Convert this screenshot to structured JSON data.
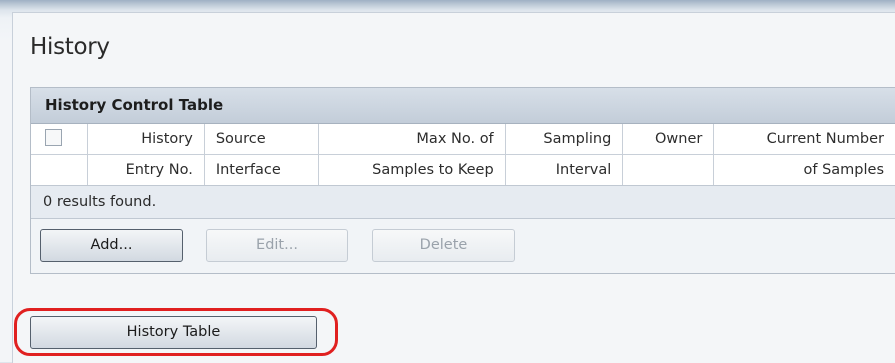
{
  "page": {
    "title": "History"
  },
  "history_control_table": {
    "caption": "History Control Table",
    "columns": [
      {
        "line1": "History",
        "line2": "Entry No."
      },
      {
        "line1": "Source",
        "line2": "Interface"
      },
      {
        "line1": "Max No. of",
        "line2": "Samples to Keep"
      },
      {
        "line1": "Sampling",
        "line2": "Interval"
      },
      {
        "line1": "Owner",
        "line2": ""
      },
      {
        "line1": "Current Number",
        "line2": "of Samples"
      }
    ],
    "results_text": "0 results found."
  },
  "buttons": {
    "add": "Add...",
    "edit": "Edit...",
    "delete": "Delete",
    "history_table": "History Table"
  },
  "colors": {
    "highlight": "#e02020",
    "caption_bg": "#c3cdd9",
    "results_bg": "#e6ebf1"
  },
  "icons": [
    "checkbox-icon"
  ]
}
